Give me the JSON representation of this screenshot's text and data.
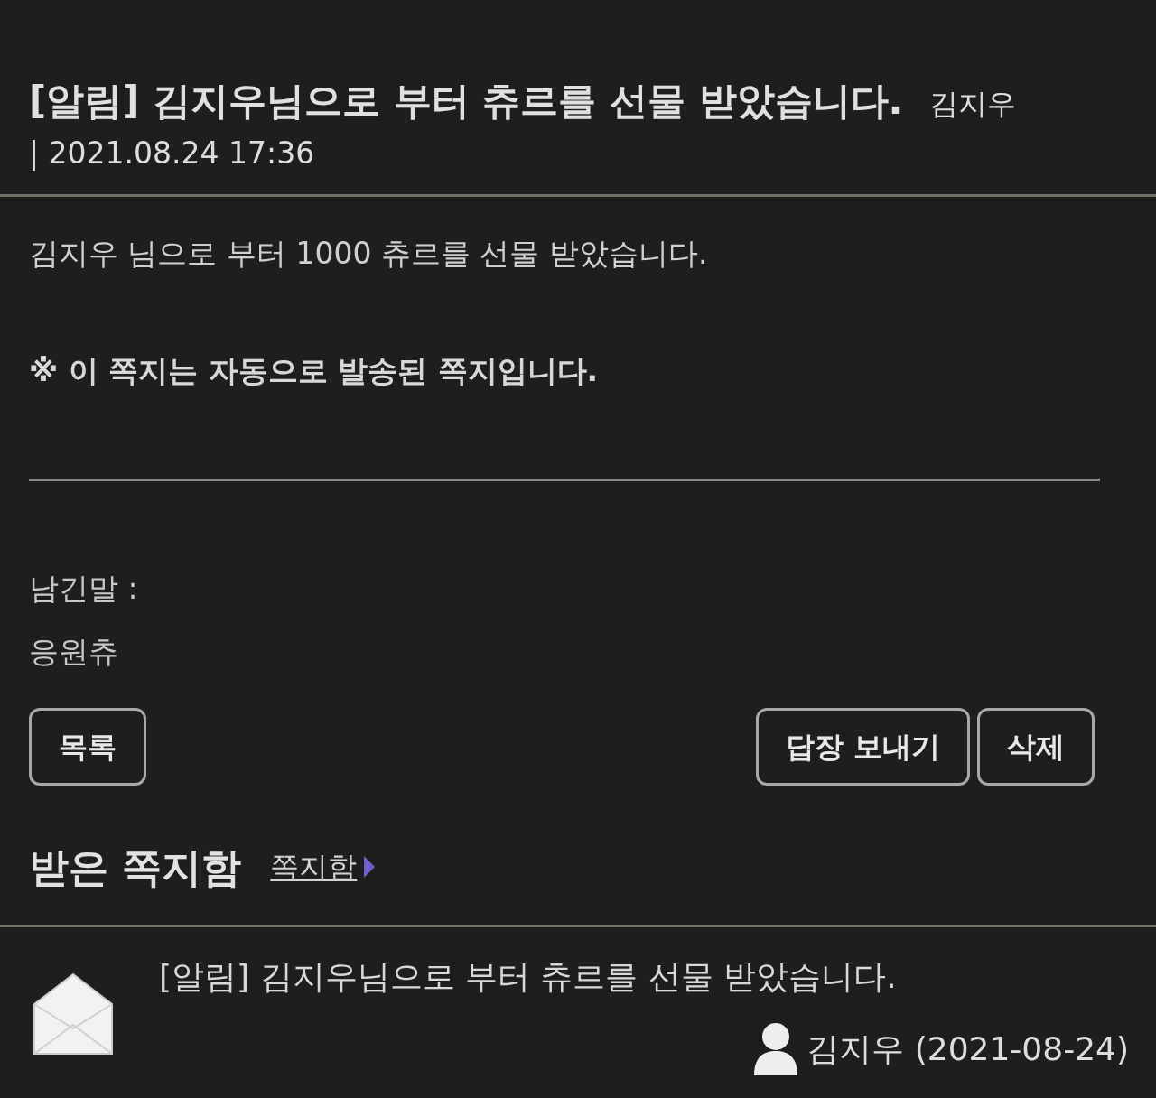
{
  "message": {
    "title": "[알림] 김지우님으로 부터 츄르를 선물 받았습니다.",
    "sender": "김지우",
    "date": "| 2021.08.24 17:36",
    "body": "김지우 님으로 부터 1000 츄르를 선물 받았습니다.",
    "notice": "※ 이 쪽지는 자동으로 발송된 쪽지입니다.",
    "note_label": "남긴말 :",
    "note": "응원츄"
  },
  "buttons_left": [
    "목록"
  ],
  "buttons_right": [
    "답장 보내기",
    "삭제"
  ],
  "inbox": {
    "heading": "받은 쪽지함",
    "link": "쪽지함",
    "items": [
      {
        "title": "[알림] 김지우님으로 부터 츄르를 선물 받았습니다.",
        "meta": "김지우 (2021-08-24)"
      }
    ]
  }
}
